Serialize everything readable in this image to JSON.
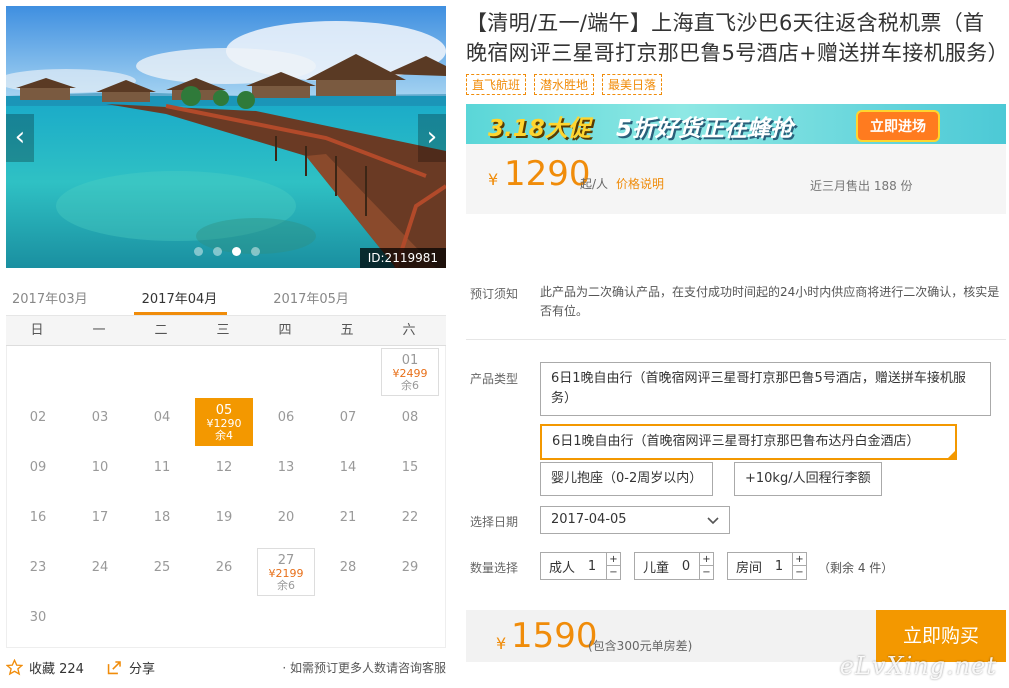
{
  "gallery": {
    "prev_icon": "‹",
    "next_icon": "›",
    "image_id": "ID:2119981",
    "dots": 4,
    "active_dot": 2
  },
  "calendar": {
    "months": [
      "2017年03月",
      "2017年04月",
      "2017年05月"
    ],
    "active_month": 1,
    "weekdays": [
      "日",
      "一",
      "二",
      "三",
      "四",
      "五",
      "六"
    ],
    "days": [
      {
        "n": "01",
        "price": "¥2499",
        "left": "余6",
        "avail": true
      },
      {
        "n": "02"
      },
      {
        "n": "03"
      },
      {
        "n": "04"
      },
      {
        "n": "05",
        "price": "¥1290",
        "left": "余4",
        "avail": true,
        "selected": true
      },
      {
        "n": "06"
      },
      {
        "n": "07"
      },
      {
        "n": "08"
      },
      {
        "n": "09"
      },
      {
        "n": "10"
      },
      {
        "n": "11"
      },
      {
        "n": "12"
      },
      {
        "n": "13"
      },
      {
        "n": "14"
      },
      {
        "n": "15"
      },
      {
        "n": "16"
      },
      {
        "n": "17"
      },
      {
        "n": "18"
      },
      {
        "n": "19"
      },
      {
        "n": "20"
      },
      {
        "n": "21"
      },
      {
        "n": "22"
      },
      {
        "n": "23"
      },
      {
        "n": "24"
      },
      {
        "n": "25"
      },
      {
        "n": "26"
      },
      {
        "n": "27",
        "price": "¥2199",
        "left": "余6",
        "avail": true
      },
      {
        "n": "28"
      },
      {
        "n": "29"
      },
      {
        "n": "30"
      }
    ],
    "first_weekday": 6
  },
  "footer": {
    "fav_label": "收藏 224",
    "share_label": "分享",
    "note": "· 如需预订更多人数请咨询客服"
  },
  "product": {
    "title": "【清明/五一/端午】上海直飞沙巴6天往返含税机票（首晚宿网评三星哥打京那巴鲁5号酒店+赠送拼车接机服务）",
    "tags": [
      "直飞航班",
      "潜水胜地",
      "最美日落"
    ]
  },
  "banner": {
    "promo": "3.18大促",
    "slogan": "5折好货正在蜂抢",
    "cta": "立即进场"
  },
  "price": {
    "yen": "¥",
    "amount": "1290",
    "unit": "起/人",
    "explain": "价格说明",
    "sold": "近三月售出 188 份"
  },
  "notice": {
    "label": "预订须知",
    "text": "此产品为二次确认产品，在支付成功时间起的24小时内供应商将进行二次确认，核实是否有位。"
  },
  "options": {
    "type_label": "产品类型",
    "types": [
      "6日1晚自由行（首晚宿网评三星哥打京那巴鲁5号酒店，赠送拼车接机服务）",
      "6日1晚自由行（首晚宿网评三星哥打京那巴鲁布达丹白金酒店）",
      "婴儿抱座（0-2周岁以内）",
      "+10kg/人回程行李额"
    ],
    "date_label": "选择日期",
    "date_value": "2017-04-05",
    "qty_label": "数量选择",
    "adult_label": "成人",
    "adult_value": "1",
    "child_label": "儿童",
    "child_value": "0",
    "room_label": "房间",
    "room_value": "1",
    "remain": "（剩余 4 件）"
  },
  "buy": {
    "yen": "¥",
    "amount": "1590",
    "include": "(包含300元单房差)",
    "button": "立即购买"
  },
  "watermark": "eLvXing.net",
  "colors": {
    "accent": "#f39800",
    "price": "#f08c0a"
  }
}
